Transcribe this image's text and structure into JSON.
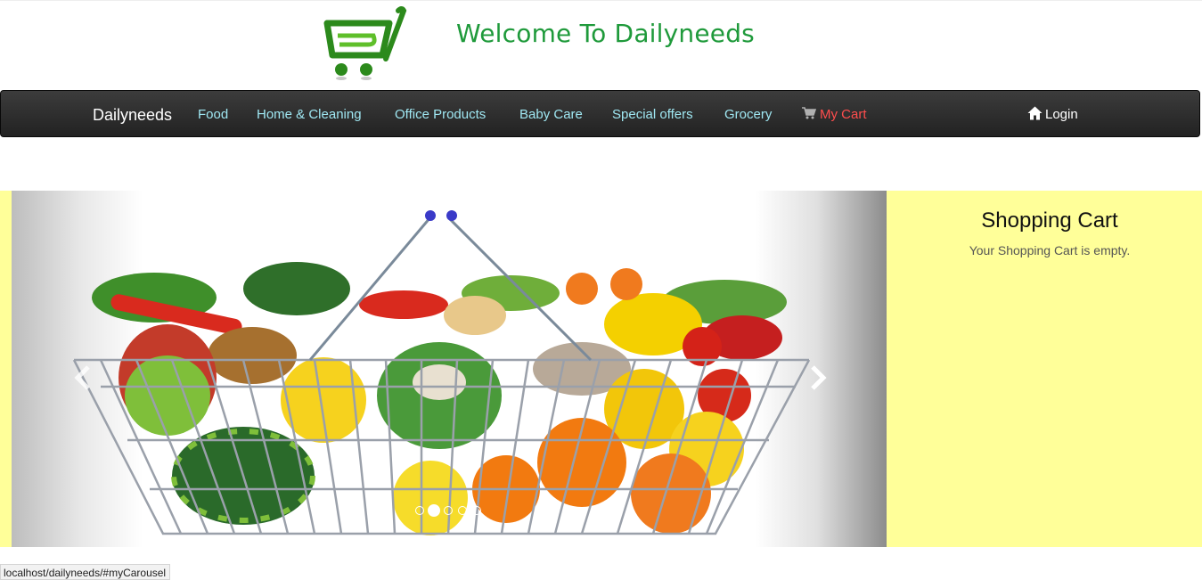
{
  "header": {
    "welcome": "Welcome To Dailyneeds",
    "logo_icon": "shopping-cart-logo-icon",
    "accent_color": "#1f9a3b"
  },
  "navbar": {
    "brand": "Dailyneeds",
    "items": [
      {
        "label": "Food"
      },
      {
        "label": "Home & Cleaning"
      },
      {
        "label": "Office Products"
      },
      {
        "label": "Baby Care"
      },
      {
        "label": "Special offers"
      },
      {
        "label": "Grocery"
      }
    ],
    "cart_label": "My Cart",
    "cart_icon": "shopping-cart-icon",
    "login_label": "Login",
    "login_icon": "home-icon",
    "link_color": "#9fe7f2",
    "cart_color": "#ff4d4d"
  },
  "carousel": {
    "image": "basket-of-vegetables-and-fruits",
    "slide_count": 5,
    "active_slide": 2,
    "prev_icon": "chevron-left-icon",
    "next_icon": "chevron-right-icon"
  },
  "cart": {
    "title": "Shopping Cart",
    "empty_message": "Your Shopping Cart is empty.",
    "background": "#ffff99"
  },
  "statusbar": {
    "url": "localhost/dailyneeds/#myCarousel"
  }
}
